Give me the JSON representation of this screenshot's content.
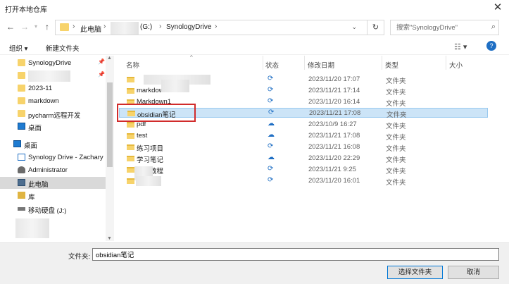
{
  "window": {
    "title": "打开本地仓库"
  },
  "navigation": {
    "path": [
      "此电脑",
      "(G:)",
      "SynologyDrive"
    ],
    "search_placeholder": "搜索\"SynologyDrive\""
  },
  "toolbar": {
    "organize_label": "组织 ▾",
    "new_folder_label": "新建文件夹"
  },
  "sidebar": {
    "items": [
      {
        "label": "SynologyDrive",
        "icon": "sync-folder-icon",
        "pinned": true
      },
      {
        "label": "",
        "icon": "folder-icon",
        "pinned": true
      },
      {
        "label": "2023-11",
        "icon": "folder-icon"
      },
      {
        "label": "markdown",
        "icon": "folder-icon"
      },
      {
        "label": "pycharm远程开发",
        "icon": "folder-icon"
      },
      {
        "label": "桌面",
        "icon": "desktop-icon"
      },
      {
        "label": "桌面",
        "icon": "desktop-icon"
      },
      {
        "label": "Synology Drive - Zachary",
        "icon": "synology-icon"
      },
      {
        "label": "Administrator",
        "icon": "user-icon"
      },
      {
        "label": "此电脑",
        "icon": "pc-icon",
        "selected": true
      },
      {
        "label": "库",
        "icon": "library-icon"
      },
      {
        "label": "移动硬盘 (J:)",
        "icon": "drive-icon"
      }
    ]
  },
  "file_list": {
    "columns": [
      "名称",
      "状态",
      "修改日期",
      "类型",
      "大小"
    ],
    "rows": [
      {
        "name": "",
        "status": "synced",
        "status_glyph": "⟳",
        "date": "2023/11/20 17:07",
        "type": "文件夹"
      },
      {
        "name": "markdown",
        "status": "synced",
        "status_glyph": "⟳",
        "date": "2023/11/21 17:14",
        "type": "文件夹"
      },
      {
        "name": "Markdown1",
        "status": "synced",
        "status_glyph": "⟳",
        "date": "2023/11/20 16:14",
        "type": "文件夹"
      },
      {
        "name": "obsidian笔记",
        "status": "synced",
        "status_glyph": "⟳",
        "date": "2023/11/21 17:08",
        "type": "文件夹",
        "selected": true
      },
      {
        "name": "pdf",
        "status": "cloud",
        "status_glyph": "☁",
        "date": "2023/10/9 16:27",
        "type": "文件夹"
      },
      {
        "name": "test",
        "status": "cloud",
        "status_glyph": "☁",
        "date": "2023/11/21 17:08",
        "type": "文件夹"
      },
      {
        "name": "练习项目",
        "status": "synced",
        "status_glyph": "⟳",
        "date": "2023/11/21 16:08",
        "type": "文件夹"
      },
      {
        "name": "学习笔记",
        "status": "cloud",
        "status_glyph": "☁",
        "date": "2023/11/20 22:29",
        "type": "文件夹"
      },
      {
        "name": "学习教程",
        "status": "synced",
        "status_glyph": "⟳",
        "date": "2023/11/21 9:25",
        "type": "文件夹"
      },
      {
        "name": "",
        "status": "synced",
        "status_glyph": "⟳",
        "date": "2023/11/20 16:01",
        "type": "文件夹"
      }
    ]
  },
  "bottom": {
    "filename_label": "文件夹:",
    "filename_value": "obsidian笔记",
    "select_button": "选择文件夹",
    "cancel_button": "取消"
  }
}
